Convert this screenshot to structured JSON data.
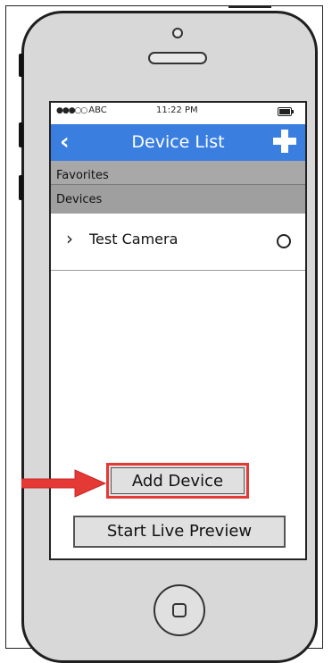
{
  "status_bar": {
    "carrier": "ABC",
    "time": "11:22 PM"
  },
  "nav": {
    "title": "Device List"
  },
  "sections": {
    "favorites": "Favorites",
    "devices": "Devices"
  },
  "devices": [
    {
      "name": "Test Camera"
    }
  ],
  "buttons": {
    "add_device": "Add Device",
    "start_live_preview": "Start Live Preview"
  },
  "annotation": {
    "highlight_color": "#e53935",
    "navbar_color": "#3a7ee0"
  }
}
